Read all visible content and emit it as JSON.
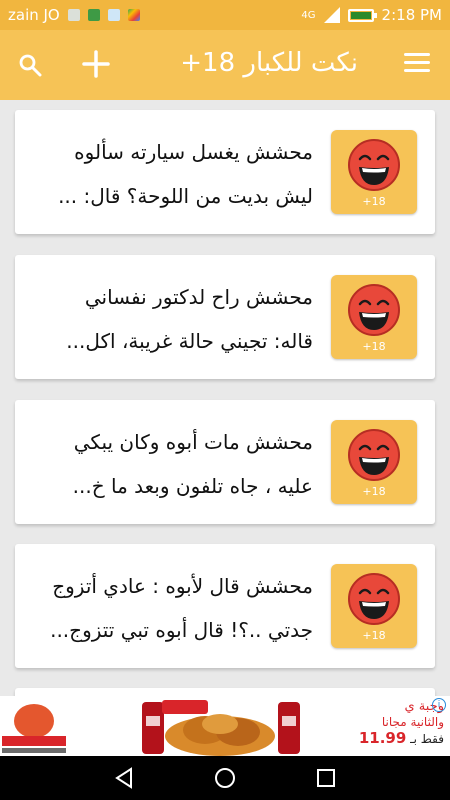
{
  "status_bar": {
    "carrier": "zain JO",
    "network": "4G",
    "time": "2:18 PM",
    "icons": [
      "download-icon",
      "app-icon",
      "gallery-icon",
      "play-store-icon",
      "signal-icon",
      "battery-icon"
    ]
  },
  "app_bar": {
    "title": "نكت للكبار 18+",
    "icons": [
      "search-icon",
      "add-icon",
      "menu-icon"
    ]
  },
  "colors": {
    "status_bar": "#f1b63f",
    "app_bar": "#f6c356",
    "card": "#ffffff",
    "background": "#e9e9e9",
    "ad_red": "#d9252a"
  },
  "jokes": [
    {
      "line1": "محشش يغسل سيارته سألوه",
      "line2": "ليش بديت من اللوحة؟ قال: ...",
      "tag": "+18"
    },
    {
      "line1": "محشش راح لدكتور نفساني",
      "line2": "قاله: تجيني حالة غريبة، اكل...",
      "tag": "+18"
    },
    {
      "line1": "محشش مات أبوه وكان يبكي",
      "line2": "عليه ، جاه تلفون وبعد ما خ...",
      "tag": "+18"
    },
    {
      "line1": "محشش قال لأبوه : عادي أتزوج",
      "line2": "جدتي ..؟! قال أبوه تبي تتزوج...",
      "tag": "+18"
    }
  ],
  "ad": {
    "line1": "وجبة ي",
    "line2": "والثانية مجانا",
    "line3_prefix": "فقط بـ",
    "price": "11.99",
    "info": "i"
  }
}
